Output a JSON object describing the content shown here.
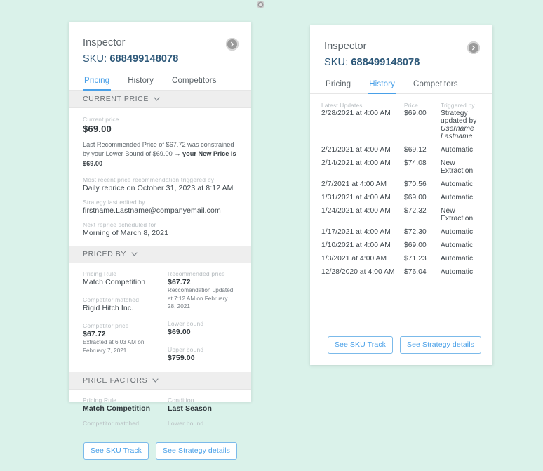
{
  "top_badge_icon": "gear-badge-icon",
  "card_pricing": {
    "title": "Inspector",
    "sku_label": "SKU:",
    "sku_value": "688499148078",
    "expand_icon": "chevron-right-circle-icon",
    "tabs": [
      {
        "label": "Pricing",
        "active": true
      },
      {
        "label": "History",
        "active": false
      },
      {
        "label": "Competitors",
        "active": false
      }
    ],
    "section_current_price": {
      "heading": "CURRENT PRICE",
      "chevron_icon": "chevron-down-icon",
      "current_price_label": "Current price",
      "current_price_value": "$69.00",
      "constraint_text_1": "Last Recommended Price of $67.72 was constrained by your Lower Bound of $69.00 ",
      "constraint_arrow": "→",
      "constraint_text_2": " your New Price is $69.00",
      "trigger_label": "Most recent price recommendation triggered by",
      "trigger_value": "Daily reprice on October 31, 2023 at 8:12 AM",
      "edited_label": "Strategy last edited by",
      "edited_value": "firstname.Lastname@companyemail.com",
      "next_label": "Next reprice scheduled for",
      "next_value": "Morning of March 8, 2021"
    },
    "section_priced_by": {
      "heading": "PRICED BY",
      "chevron_icon": "chevron-down-icon",
      "pricing_rule_label": "Pricing Rule",
      "pricing_rule_value": "Match Competition",
      "competitor_matched_label": "Competitor matched",
      "competitor_matched_value": "Rigid Hitch Inc.",
      "competitor_price_label": "Competitor price",
      "competitor_price_value": "$67.72",
      "competitor_price_note": "Extracted at 6:03 AM on February 7, 2021",
      "recommended_price_label": "Recommended price",
      "recommended_price_value": "$67.72",
      "recommended_price_note": "Reccomendation updated at 7:12 AM on February 28, 2021",
      "lower_bound_label": "Lower bound",
      "lower_bound_value": "$69.00",
      "upper_bound_label": "Upper bound",
      "upper_bound_value": "$759.00"
    },
    "section_price_factors": {
      "heading": "PRICE FACTORS",
      "chevron_icon": "chevron-down-icon",
      "pricing_rule_label": "Pricing Rule",
      "pricing_rule_value": "Match Competition",
      "competitor_matched_label": "Competitor matched",
      "condition_label": "Condition",
      "condition_value": "Last Season",
      "lower_bound_label": "Lower bound"
    },
    "buttons": {
      "sku_track": "See SKU Track",
      "strategy_details": "See Strategy details"
    }
  },
  "card_history": {
    "title": "Inspector",
    "sku_label": "SKU:",
    "sku_value": "688499148078",
    "expand_icon": "chevron-right-circle-icon",
    "tabs": [
      {
        "label": "Pricing",
        "active": false
      },
      {
        "label": "History",
        "active": true
      },
      {
        "label": "Competitors",
        "active": false
      }
    ],
    "table": {
      "headers": [
        "Latest Updates",
        "Price",
        "Triggered by"
      ],
      "rows": [
        {
          "date": "2/28/2021 at 4:00 AM",
          "price": "$69.00",
          "trigger": "Strategy updated by",
          "trigger_sub": "Username Lastname"
        },
        {
          "date": "2/21/2021 at 4:00 AM",
          "price": "$69.12",
          "trigger": "Automatic",
          "trigger_sub": ""
        },
        {
          "date": "2/14/2021 at 4:00 AM",
          "price": "$74.08",
          "trigger": "New Extraction",
          "trigger_sub": ""
        },
        {
          "date": "2/7/2021 at 4:00 AM",
          "price": "$70.56",
          "trigger": "Automatic",
          "trigger_sub": ""
        },
        {
          "date": "1/31/2021 at 4:00 AM",
          "price": "$69.00",
          "trigger": "Automatic",
          "trigger_sub": ""
        },
        {
          "date": "1/24/2021 at 4:00 AM",
          "price": "$72.32",
          "trigger": "New Extraction",
          "trigger_sub": ""
        },
        {
          "date": "1/17/2021 at 4:00 AM",
          "price": "$72.30",
          "trigger": "Automatic",
          "trigger_sub": ""
        },
        {
          "date": "1/10/2021 at 4:00 AM",
          "price": "$69.00",
          "trigger": "Automatic",
          "trigger_sub": ""
        },
        {
          "date": "1/3/2021 at 4:00 AM",
          "price": "$71.23",
          "trigger": "Automatic",
          "trigger_sub": ""
        },
        {
          "date": "12/28/2020 at 4:00 AM",
          "price": "$76.04",
          "trigger": "Automatic",
          "trigger_sub": ""
        }
      ]
    },
    "buttons": {
      "sku_track": "See SKU Track",
      "strategy_details": "See Strategy details"
    }
  },
  "colors": {
    "background": "#daf2ea",
    "card": "#ffffff",
    "accent_blue": "#49a0e8",
    "sku_blue": "#2c5778",
    "section_bar": "#eeeeee",
    "label_gray": "#b6bcc0",
    "text_dark": "#3e464c"
  }
}
